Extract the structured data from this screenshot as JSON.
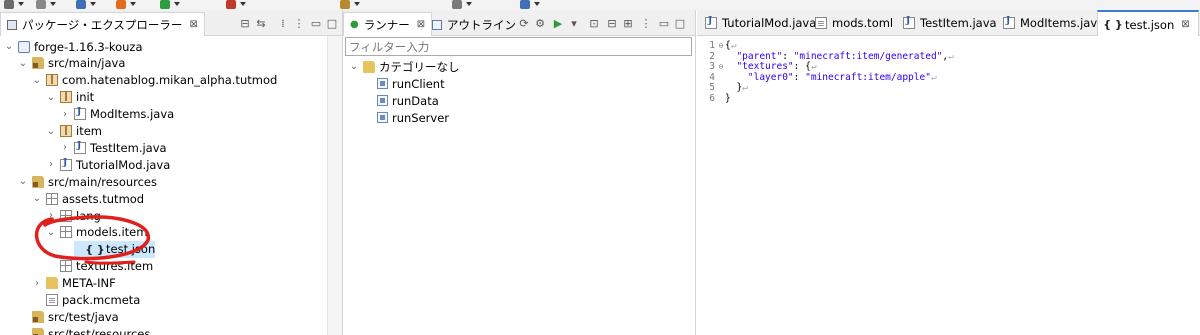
{
  "toolbar": {
    "icons": [
      "save-icon",
      "print-icon",
      "debug-icon",
      "run-icon",
      "tools-icon",
      "open-type-icon",
      "search-icon",
      "nav-back-icon",
      "nav-forward-icon"
    ]
  },
  "left_pane": {
    "tab_label": "パッケージ・エクスプローラー",
    "close_glyph": "⊠",
    "tree": [
      {
        "label": "forge-1.16.3-kouza",
        "icon": "project-icon",
        "expanded": true
      },
      {
        "label": "src/main/java",
        "icon": "source-folder-icon",
        "expanded": true
      },
      {
        "label": "com.hatenablog.mikan_alpha.tutmod",
        "icon": "package-icon",
        "expanded": true
      },
      {
        "label": "init",
        "icon": "package-icon",
        "expanded": true
      },
      {
        "label": "ModItems.java",
        "icon": "java-file-icon",
        "expanded": false
      },
      {
        "label": "item",
        "icon": "package-icon",
        "expanded": true
      },
      {
        "label": "TestItem.java",
        "icon": "java-file-icon",
        "expanded": false
      },
      {
        "label": "TutorialMod.java",
        "icon": "java-file-icon",
        "expanded": false
      },
      {
        "label": "src/main/resources",
        "icon": "source-folder-icon",
        "expanded": true
      },
      {
        "label": "assets.tutmod",
        "icon": "package-icon",
        "expanded": true
      },
      {
        "label": "lang",
        "icon": "package-icon",
        "expanded": false
      },
      {
        "label": "models.item",
        "icon": "package-icon",
        "expanded": true
      },
      {
        "label": "test.json",
        "icon": "json-file-icon",
        "expanded": false
      },
      {
        "label": "textures.item",
        "icon": "package-icon",
        "expanded": false
      },
      {
        "label": "META-INF",
        "icon": "folder-icon",
        "expanded": false
      },
      {
        "label": "pack.mcmeta",
        "icon": "file-icon",
        "expanded": false
      },
      {
        "label": "src/test/java",
        "icon": "source-folder-icon",
        "expanded": false
      },
      {
        "label": "src/test/resources",
        "icon": "source-folder-icon",
        "expanded": false
      }
    ]
  },
  "middle_pane": {
    "tab_runner": "ランナー",
    "tab_outline": "アウトライン",
    "close_glyph": "⊠",
    "filter_placeholder": "フィルター入力",
    "category": "カテゴリーなし",
    "runs": [
      "runClient",
      "runData",
      "runServer"
    ]
  },
  "editor": {
    "tabs": [
      {
        "label": "TutorialMod.java",
        "active": false
      },
      {
        "label": "mods.toml",
        "active": false
      },
      {
        "label": "TestItem.java",
        "active": false
      },
      {
        "label": "ModItems.java",
        "active": false
      },
      {
        "label": "test.json",
        "active": true
      }
    ],
    "json_tab_glyph": "{ }",
    "close_glyph": "⊠",
    "lines": [
      {
        "num": "1",
        "fold": "⊖",
        "parts": [
          [
            "{",
            "t"
          ],
          [
            "↵",
            "c"
          ]
        ]
      },
      {
        "num": "2",
        "fold": "",
        "parts": [
          [
            "  ",
            "t"
          ],
          [
            "\"parent\"",
            "s"
          ],
          [
            ": ",
            "t"
          ],
          [
            "\"minecraft:item/generated\"",
            "s"
          ],
          [
            ",",
            "t"
          ],
          [
            "↵",
            "c"
          ]
        ]
      },
      {
        "num": "3",
        "fold": "⊖",
        "parts": [
          [
            "  ",
            "t"
          ],
          [
            "\"textures\"",
            "s"
          ],
          [
            ": {",
            "t"
          ],
          [
            "↵",
            "c"
          ]
        ]
      },
      {
        "num": "4",
        "fold": "",
        "parts": [
          [
            "    ",
            "t"
          ],
          [
            "\"layer0\"",
            "s"
          ],
          [
            ": ",
            "t"
          ],
          [
            "\"minecraft:item/apple\"",
            "s"
          ],
          [
            "↵",
            "c"
          ]
        ]
      },
      {
        "num": "5",
        "fold": "",
        "parts": [
          [
            "  }",
            "t"
          ],
          [
            "↵",
            "c"
          ]
        ]
      },
      {
        "num": "6",
        "fold": "",
        "parts": [
          [
            "}",
            "t"
          ]
        ]
      }
    ]
  },
  "colors": {
    "annotation": "#e0201c",
    "selection": "#cce8ff",
    "json_string": "#2a00ff"
  }
}
